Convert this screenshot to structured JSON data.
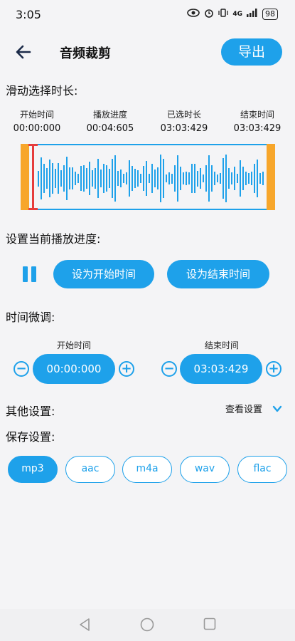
{
  "status": {
    "time": "3:05",
    "network": "4G",
    "battery": "98"
  },
  "header": {
    "title": "音频裁剪",
    "export_label": "导出"
  },
  "slide_select": {
    "label": "滑动选择时长:",
    "stats": [
      {
        "key": "开始时间",
        "value": "00:00:000"
      },
      {
        "key": "播放进度",
        "value": "00:04:605"
      },
      {
        "key": "已选时长",
        "value": "03:03:429"
      },
      {
        "key": "结束时间",
        "value": "03:03:429"
      }
    ]
  },
  "progress_setting": {
    "label": "设置当前播放进度:",
    "set_start_label": "设为开始时间",
    "set_end_label": "设为结束时间"
  },
  "fine_tune": {
    "label": "时间微调:",
    "start_label": "开始时间",
    "start_value": "00:00:000",
    "end_label": "结束时间",
    "end_value": "03:03:429"
  },
  "other_settings": {
    "label": "其他设置:",
    "view_label": "查看设置"
  },
  "save_settings": {
    "label": "保存设置:",
    "formats": [
      "mp3",
      "aac",
      "m4a",
      "wav",
      "flac"
    ],
    "selected": "mp3"
  },
  "colors": {
    "accent": "#1ea1ea",
    "handle": "#f7a62b",
    "playhead": "#e63c3c"
  }
}
